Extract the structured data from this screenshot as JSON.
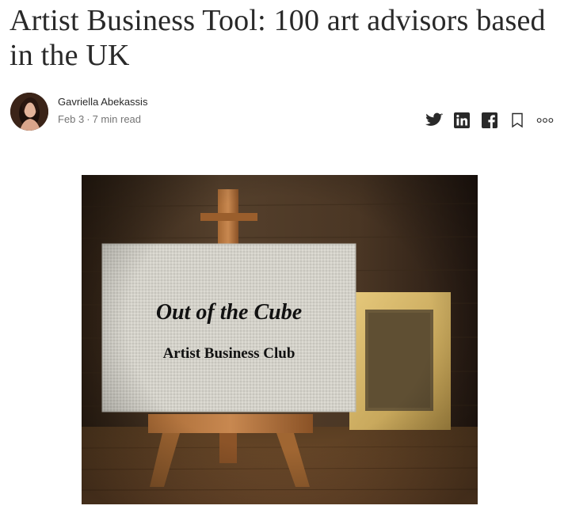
{
  "article": {
    "title": "Artist Business Tool: 100 art advisors based in the UK",
    "author": "Gavriella Abekassis",
    "date": "Feb 3",
    "separator": "·",
    "read_time": "7 min read"
  },
  "actions": {
    "icons": [
      "twitter-icon",
      "linkedin-icon",
      "facebook-icon",
      "bookmark-icon",
      "more-icon"
    ]
  },
  "hero": {
    "canvas_line1": "Out of the Cube",
    "canvas_line2": "Artist Business Club"
  }
}
